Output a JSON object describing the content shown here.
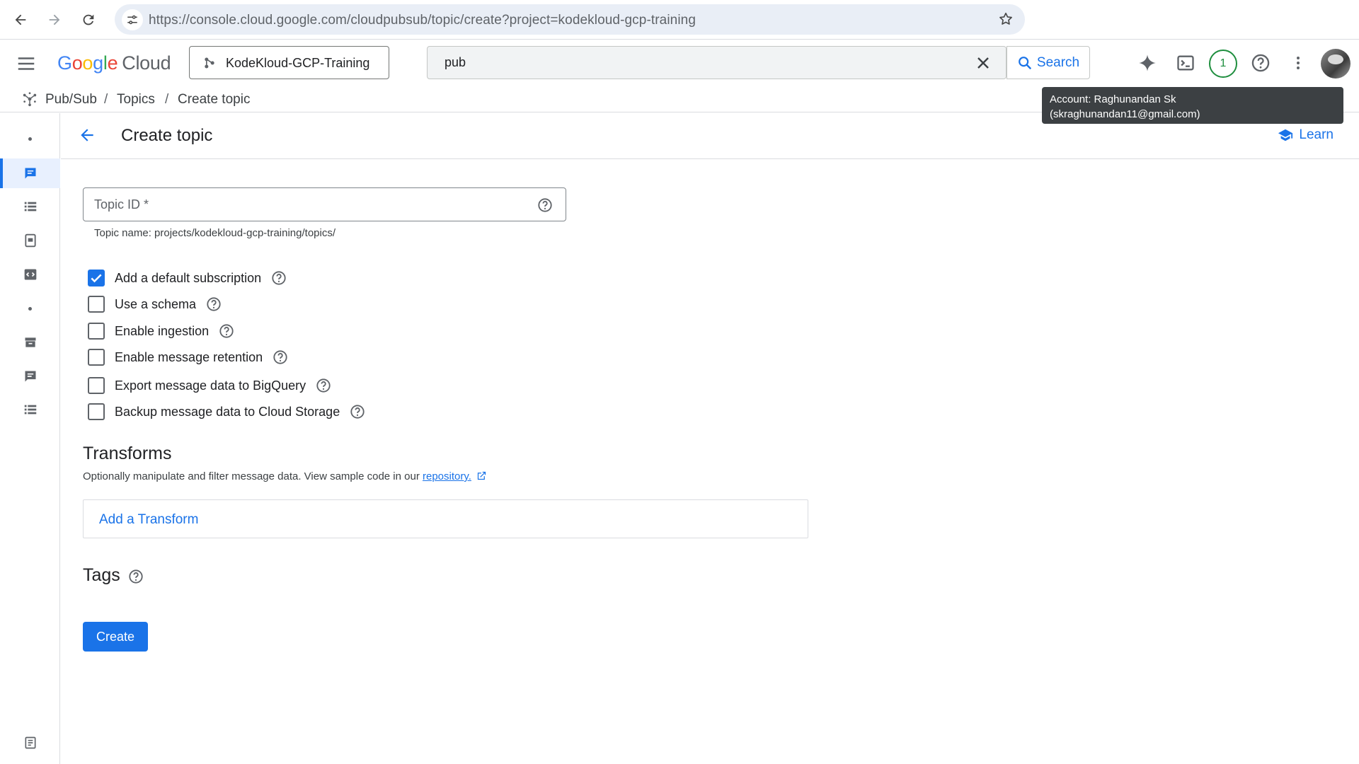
{
  "browser": {
    "url_host": "https://console.cloud.google.com",
    "url_path": "/cloudpubsub/topic/create?project=kodekloud-gcp-training"
  },
  "header": {
    "logo_letters": [
      "G",
      "o",
      "o",
      "g",
      "l",
      "e"
    ],
    "logo_product": "Cloud",
    "project_name": "KodeKloud-GCP-Training",
    "search_value": "pub",
    "search_button": "Search",
    "notification_count": "1"
  },
  "breadcrumb": {
    "items": [
      "Pub/Sub",
      "Topics",
      "Create topic"
    ],
    "separator": "/"
  },
  "tooltip": {
    "line1": "Account: Raghunandan Sk",
    "line2": "(skraghunandan11@gmail.com)"
  },
  "page": {
    "title": "Create topic",
    "learn_label": "Learn"
  },
  "form": {
    "topic_id_placeholder": "Topic ID *",
    "topic_hint": "Topic name: projects/kodekloud-gcp-training/topics/",
    "options": [
      {
        "label": "Add a default subscription",
        "checked": true
      },
      {
        "label": "Use a schema",
        "checked": false
      },
      {
        "label": "Enable ingestion",
        "checked": false
      },
      {
        "label": "Enable message retention",
        "checked": false
      },
      {
        "label": "Export message data to BigQuery",
        "checked": false
      },
      {
        "label": "Backup message data to Cloud Storage",
        "checked": false
      }
    ],
    "transforms_title": "Transforms",
    "transforms_desc": "Optionally manipulate and filter message data. View sample code in our ",
    "transforms_link": "repository.",
    "add_transform": "Add a Transform",
    "tags_title": "Tags",
    "create_label": "Create"
  },
  "colors": {
    "accent": "#1a73e8",
    "notification": "#1e8e3e"
  }
}
